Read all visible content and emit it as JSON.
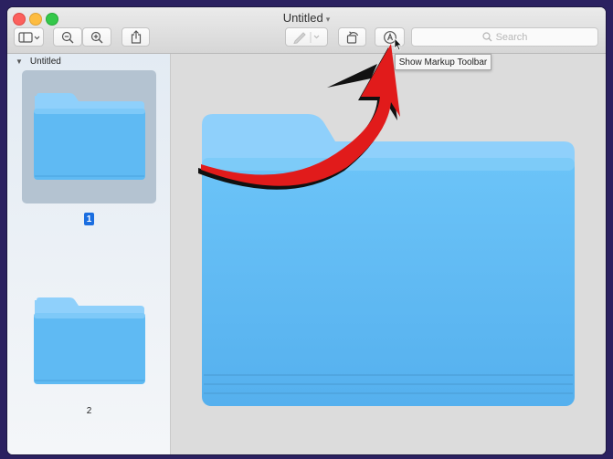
{
  "window": {
    "title": "Untitled"
  },
  "toolbar": {
    "search_placeholder": "Search",
    "tooltip": "Show Markup Toolbar",
    "icons": [
      "sidebar-view-icon",
      "zoom-out-icon",
      "zoom-in-icon",
      "share-icon",
      "pen-icon",
      "rotate-icon",
      "markup-icon",
      "search-icon"
    ]
  },
  "sidebar": {
    "header": "Untitled",
    "pages": [
      {
        "label": "1",
        "selected": true
      },
      {
        "label": "2",
        "selected": false
      }
    ]
  },
  "colors": {
    "accent": "#1b6ee0",
    "folder_front": "#5fbaf3",
    "folder_back": "#8fd0fb",
    "arrow": "#e11b1b"
  }
}
